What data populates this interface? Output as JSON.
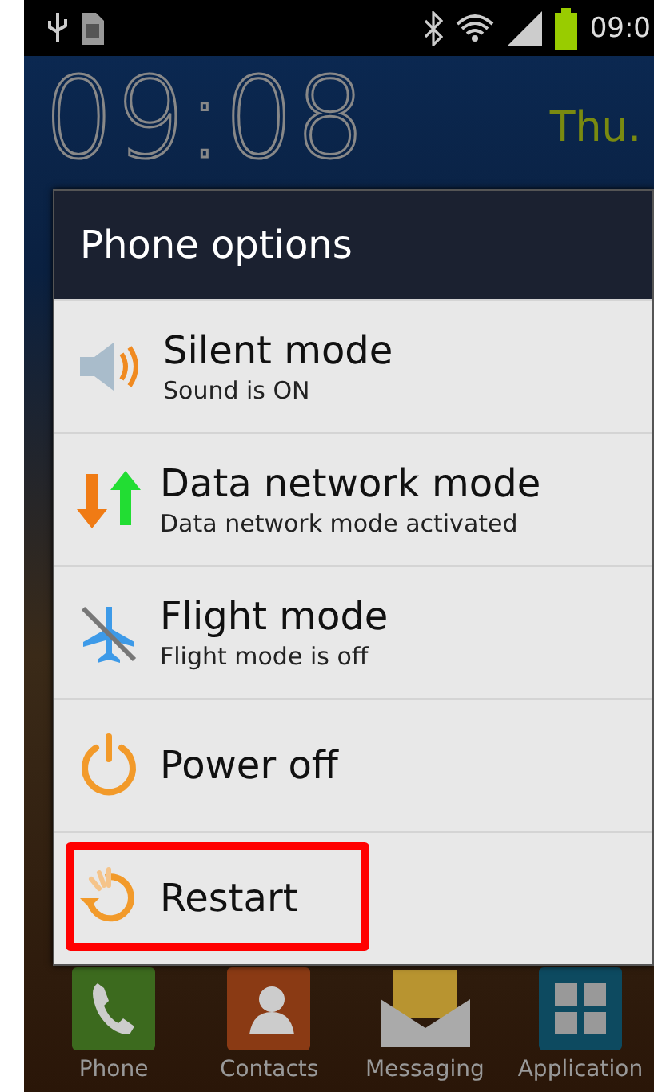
{
  "status_bar": {
    "time": "09:0"
  },
  "home": {
    "clock": "09:08",
    "day": "Thu."
  },
  "dialog": {
    "title": "Phone options",
    "items": [
      {
        "kind": "sound",
        "title": "Silent mode",
        "subtitle": "Sound is ON",
        "highlighted": false
      },
      {
        "kind": "data",
        "title": "Data network mode",
        "subtitle": "Data network mode activated",
        "highlighted": false
      },
      {
        "kind": "flight",
        "title": "Flight mode",
        "subtitle": "Flight mode is off",
        "highlighted": false
      },
      {
        "kind": "power",
        "title": "Power off",
        "highlighted": false
      },
      {
        "kind": "restart",
        "title": "Restart",
        "highlighted": true
      }
    ]
  },
  "dock": [
    {
      "kind": "phone",
      "label": "Phone"
    },
    {
      "kind": "contacts",
      "label": "Contacts"
    },
    {
      "kind": "messaging",
      "label": "Messaging"
    },
    {
      "kind": "apps",
      "label": "Application"
    }
  ]
}
